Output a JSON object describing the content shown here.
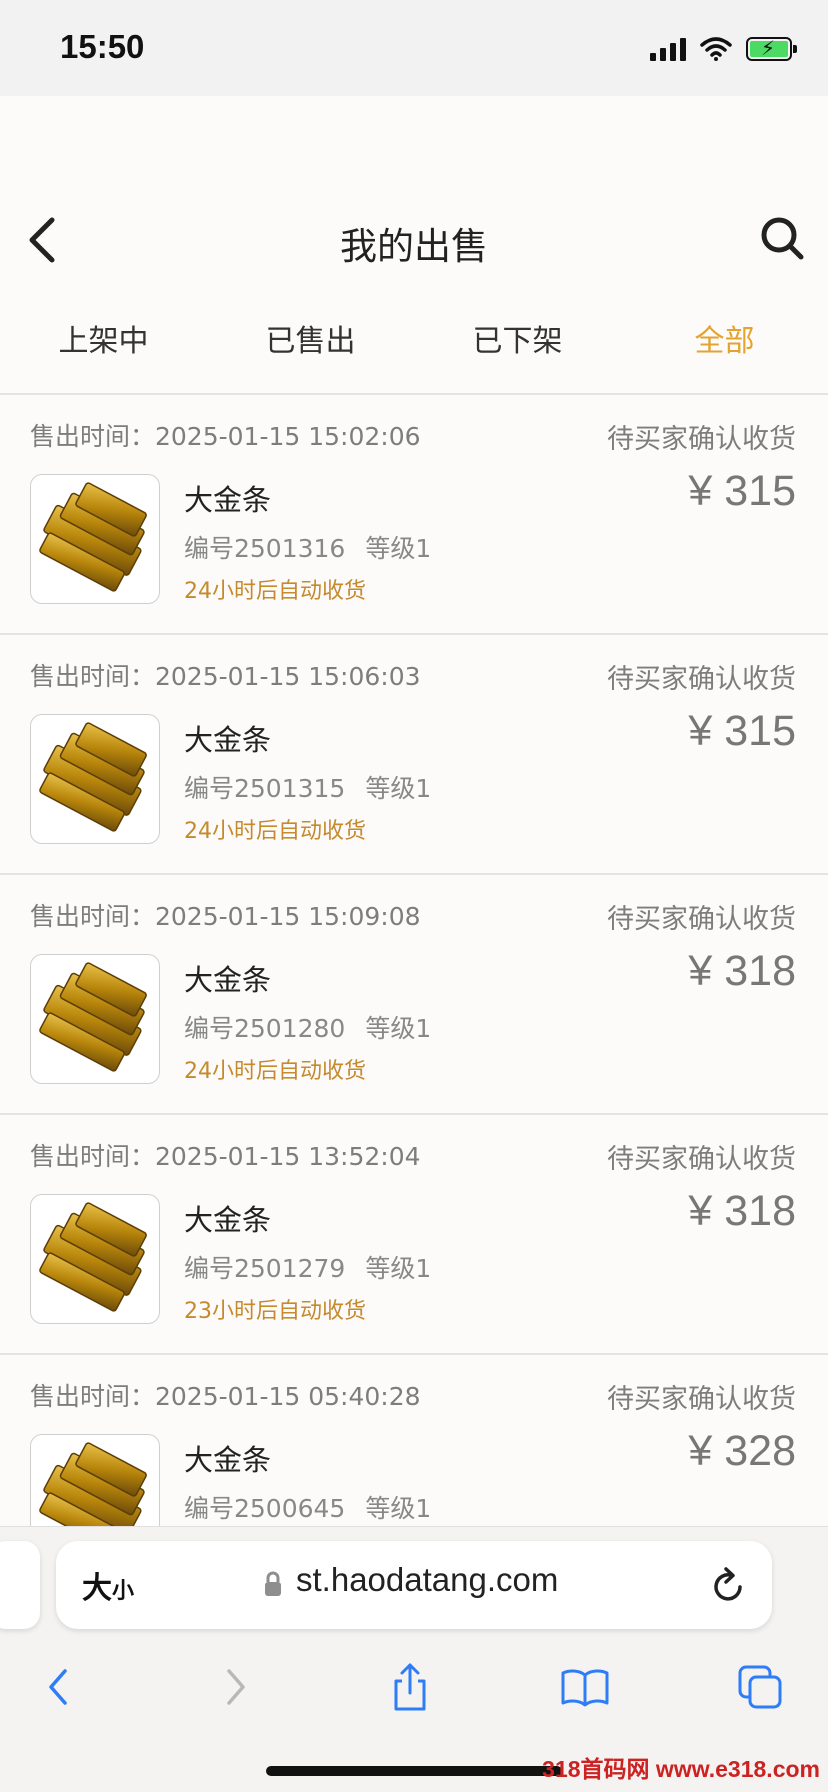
{
  "status": {
    "time": "15:50"
  },
  "nav": {
    "title": "我的出售"
  },
  "tabs": [
    {
      "label": "上架中",
      "active": false
    },
    {
      "label": "已售出",
      "active": false
    },
    {
      "label": "已下架",
      "active": false
    },
    {
      "label": "全部",
      "active": true
    }
  ],
  "orders": [
    {
      "sold_time": "售出时间：2025-01-15 15:02:06",
      "status": "待买家确认收货",
      "name": "大金条",
      "serial": "编号2501316",
      "level": "等级1",
      "auto_receive": "24小时后自动收货",
      "price": "¥ 315"
    },
    {
      "sold_time": "售出时间：2025-01-15 15:06:03",
      "status": "待买家确认收货",
      "name": "大金条",
      "serial": "编号2501315",
      "level": "等级1",
      "auto_receive": "24小时后自动收货",
      "price": "¥ 315"
    },
    {
      "sold_time": "售出时间：2025-01-15 15:09:08",
      "status": "待买家确认收货",
      "name": "大金条",
      "serial": "编号2501280",
      "level": "等级1",
      "auto_receive": "24小时后自动收货",
      "price": "¥ 318"
    },
    {
      "sold_time": "售出时间：2025-01-15 13:52:04",
      "status": "待买家确认收货",
      "name": "大金条",
      "serial": "编号2501279",
      "level": "等级1",
      "auto_receive": "23小时后自动收货",
      "price": "¥ 318"
    },
    {
      "sold_time": "售出时间：2025-01-15 05:40:28",
      "status": "待买家确认收货",
      "name": "大金条",
      "serial": "编号2500645",
      "level": "等级1",
      "auto_receive": "",
      "price": "¥ 328"
    }
  ],
  "browser": {
    "text_size_big": "大",
    "text_size_small": "小",
    "url": "st.haodatang.com"
  },
  "watermark": "318首码网 www.e318.com",
  "colors": {
    "accent": "#e3a32e",
    "auto_receive": "#c58a2e",
    "gold": "#b8860b"
  }
}
